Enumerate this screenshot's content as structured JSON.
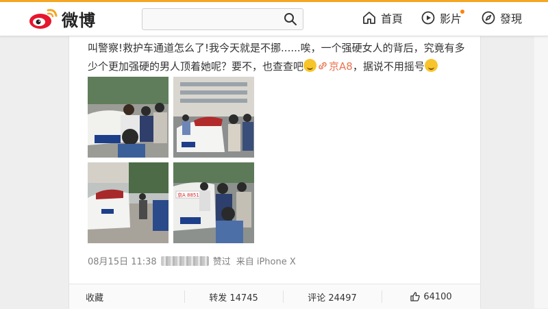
{
  "header": {
    "logo_text": "微博",
    "search_placeholder": "",
    "nav": [
      {
        "label": "首頁",
        "icon": "home-icon"
      },
      {
        "label": "影片",
        "icon": "video-icon",
        "has_badge": true
      },
      {
        "label": "發現",
        "icon": "compass-icon"
      }
    ]
  },
  "post": {
    "text_part1": "叫警察!救护车通道怎么了!我今天就是不挪......唉，一个强硬女人的背后，究竟有多少个更加强硬的男人顶着她呢？要不，也查查吧",
    "link_text": "京A8",
    "text_part2": "，据说不用摇号",
    "plate_text": "京A 88519",
    "meta": {
      "date": "08月15日 11:38",
      "liked_label": "赞过",
      "source": "来自 iPhone X"
    }
  },
  "actions": {
    "favorite": "收藏",
    "repost": "转发 14745",
    "comment": "评论 24497",
    "like": "64100"
  },
  "colors": {
    "accent": "#ff8200",
    "link": "#eb7350",
    "brand_red": "#e6162d"
  }
}
